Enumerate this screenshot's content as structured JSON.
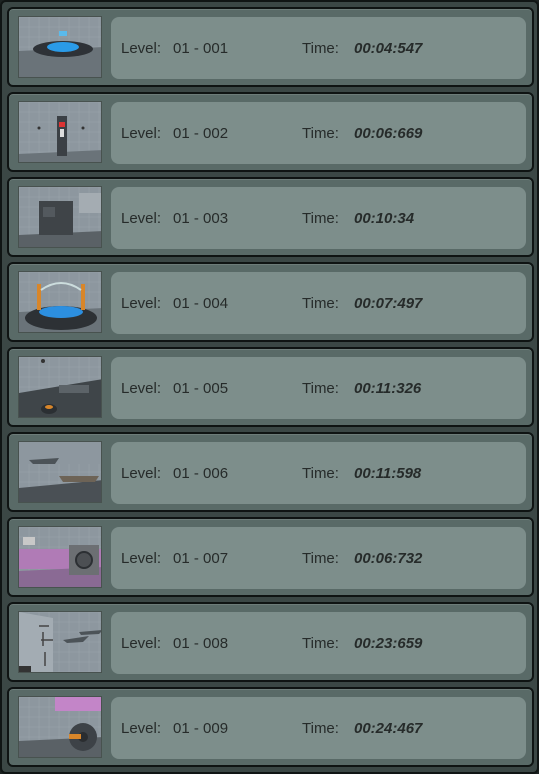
{
  "labels": {
    "level": "Level:",
    "time": "Time:"
  },
  "entries": [
    {
      "level": "01 - 001",
      "time": "00:04:547",
      "thumbnail_icon": "level-preview-teleporter-pad"
    },
    {
      "level": "01 - 002",
      "time": "00:06:669",
      "thumbnail_icon": "level-preview-wall-switch"
    },
    {
      "level": "01 - 003",
      "time": "00:10:34",
      "thumbnail_icon": "level-preview-blocks-room"
    },
    {
      "level": "01 - 004",
      "time": "00:07:497",
      "thumbnail_icon": "level-preview-portal-arch"
    },
    {
      "level": "01 - 005",
      "time": "00:11:326",
      "thumbnail_icon": "level-preview-dark-floor"
    },
    {
      "level": "01 - 006",
      "time": "00:11:598",
      "thumbnail_icon": "level-preview-floating-platforms"
    },
    {
      "level": "01 - 007",
      "time": "00:06:732",
      "thumbnail_icon": "level-preview-cube-room"
    },
    {
      "level": "01 - 008",
      "time": "00:23:659",
      "thumbnail_icon": "level-preview-maze-wall"
    },
    {
      "level": "01 - 009",
      "time": "00:24:467",
      "thumbnail_icon": "level-preview-turret-room"
    }
  ],
  "colors": {
    "panel": "#3b4745",
    "row": "#596a67",
    "info": "#7d8e8b",
    "text": "#262b2a"
  }
}
